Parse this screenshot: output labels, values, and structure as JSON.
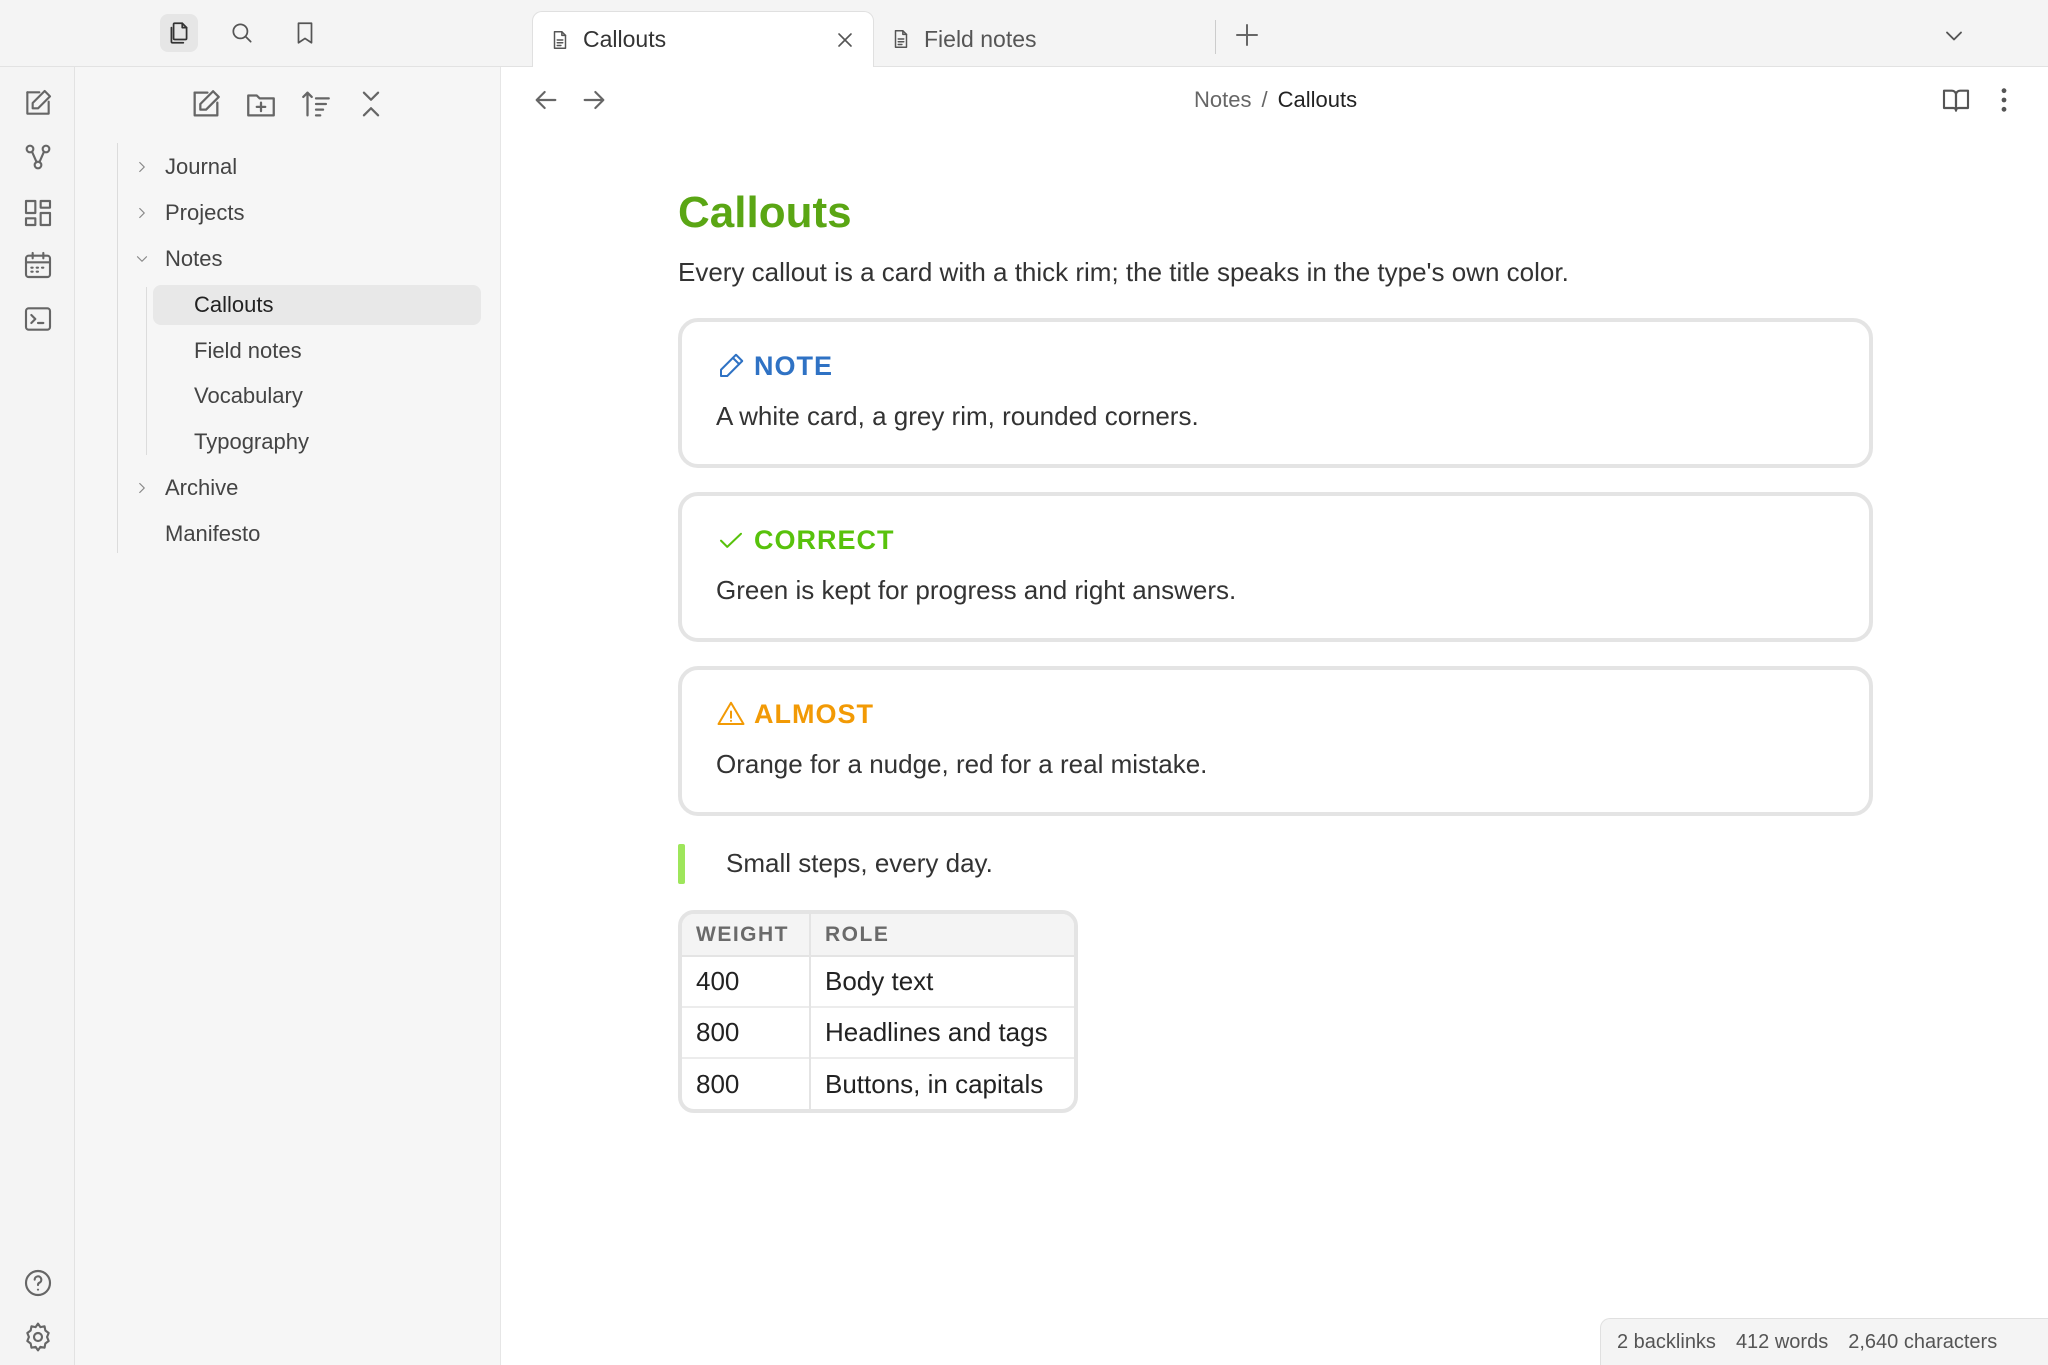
{
  "tabs": [
    {
      "label": "Callouts",
      "active": true
    },
    {
      "label": "Field notes",
      "active": false
    }
  ],
  "breadcrumb": {
    "parent": "Notes",
    "separator": "/",
    "current": "Callouts"
  },
  "file_tree": {
    "folders": [
      {
        "label": "Journal",
        "expanded": false
      },
      {
        "label": "Projects",
        "expanded": false
      },
      {
        "label": "Notes",
        "expanded": true,
        "children": [
          "Callouts",
          "Field notes",
          "Vocabulary",
          "Typography"
        ],
        "selected": "Callouts"
      },
      {
        "label": "Archive",
        "expanded": false
      }
    ],
    "files": [
      "Manifesto"
    ]
  },
  "note": {
    "title": "Callouts",
    "intro": "Every callout is a card with a thick rim; the title speaks in the type's own color.",
    "callouts": [
      {
        "type": "note",
        "title": "NOTE",
        "icon": "pencil-icon",
        "color": "#2f72c4",
        "body": "A white card, a grey rim, rounded corners."
      },
      {
        "type": "correct",
        "title": "CORRECT",
        "icon": "check-icon",
        "color": "#58c20c",
        "body": "Green is kept for progress and right answers."
      },
      {
        "type": "almost",
        "title": "ALMOST",
        "icon": "warning-icon",
        "color": "#f29a05",
        "body": "Orange for a nudge, red for a real mistake."
      }
    ],
    "quote": "Small steps, every day.",
    "table": {
      "headers": [
        "WEIGHT",
        "ROLE"
      ],
      "rows": [
        [
          "400",
          "Body text"
        ],
        [
          "800",
          "Headlines and tags"
        ],
        [
          "800",
          "Buttons, in capitals"
        ]
      ]
    }
  },
  "status": {
    "backlinks": "2 backlinks",
    "words": "412 words",
    "characters": "2,640 characters"
  },
  "colors": {
    "accent": "#5aa614",
    "quote_bar": "#9ee65b"
  }
}
